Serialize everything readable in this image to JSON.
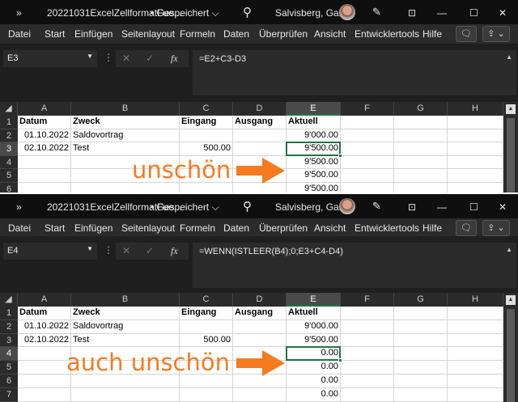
{
  "window": {
    "nav_icon": "»",
    "filename": "20221031ExcelZellformatFue...",
    "save_status": "• Gespeichert ⌵",
    "user": "Salvisberg, Gaby",
    "minimize": "—",
    "maximize": "☐",
    "close": "✕",
    "search_icon": "⚲"
  },
  "ribbon": {
    "tabs": [
      "Datei",
      "Start",
      "Einfügen",
      "Seitenlayout",
      "Formeln",
      "Daten",
      "Überprüfen",
      "Ansicht",
      "Entwicklertools",
      "Hilfe"
    ],
    "comment_icon": "🗨",
    "share_icon": "⇪ ⌄"
  },
  "columns": [
    "A",
    "B",
    "C",
    "D",
    "E",
    "F",
    "G",
    "H"
  ],
  "panels": [
    {
      "name_box": "E3",
      "formula": "=E2+C3-D3",
      "selected_col": "E",
      "selected_row": 3,
      "rows": [
        {
          "n": "1",
          "cells": [
            "Datum",
            "Zweck",
            "Eingang",
            "Ausgang",
            "Aktuell",
            "",
            "",
            ""
          ]
        },
        {
          "n": "2",
          "cells": [
            "01.10.2022",
            "Saldovortrag",
            "",
            "",
            "9'000.00",
            "",
            "",
            ""
          ]
        },
        {
          "n": "3",
          "cells": [
            "02.10.2022",
            "Test",
            "500.00",
            "",
            "9'500.00",
            "",
            "",
            ""
          ]
        },
        {
          "n": "4",
          "cells": [
            "",
            "",
            "",
            "",
            "9'500.00",
            "",
            "",
            ""
          ]
        },
        {
          "n": "5",
          "cells": [
            "",
            "",
            "",
            "",
            "9'500.00",
            "",
            "",
            ""
          ]
        },
        {
          "n": "6",
          "cells": [
            "",
            "",
            "",
            "",
            "9'500.00",
            "",
            "",
            ""
          ]
        }
      ],
      "annotation": "unschön"
    },
    {
      "name_box": "E4",
      "formula": "=WENN(ISTLEER(B4);0;E3+C4-D4)",
      "selected_col": "E",
      "selected_row": 4,
      "rows": [
        {
          "n": "1",
          "cells": [
            "Datum",
            "Zweck",
            "Eingang",
            "Ausgang",
            "Aktuell",
            "",
            "",
            ""
          ]
        },
        {
          "n": "2",
          "cells": [
            "01.10.2022",
            "Saldovortrag",
            "",
            "",
            "9'000.00",
            "",
            "",
            ""
          ]
        },
        {
          "n": "3",
          "cells": [
            "02.10.2022",
            "Test",
            "500.00",
            "",
            "9'500.00",
            "",
            "",
            ""
          ]
        },
        {
          "n": "4",
          "cells": [
            "",
            "",
            "",
            "",
            "0.00",
            "",
            "",
            ""
          ]
        },
        {
          "n": "5",
          "cells": [
            "",
            "",
            "",
            "",
            "0.00",
            "",
            "",
            ""
          ]
        },
        {
          "n": "6",
          "cells": [
            "",
            "",
            "",
            "",
            "0.00",
            "",
            "",
            ""
          ]
        },
        {
          "n": "7",
          "cells": [
            "",
            "",
            "",
            "",
            "0.00",
            "",
            "",
            ""
          ]
        }
      ],
      "annotation": "auch unschön"
    }
  ],
  "colors": {
    "accent": "#217346",
    "annotation": "#f47b20"
  }
}
